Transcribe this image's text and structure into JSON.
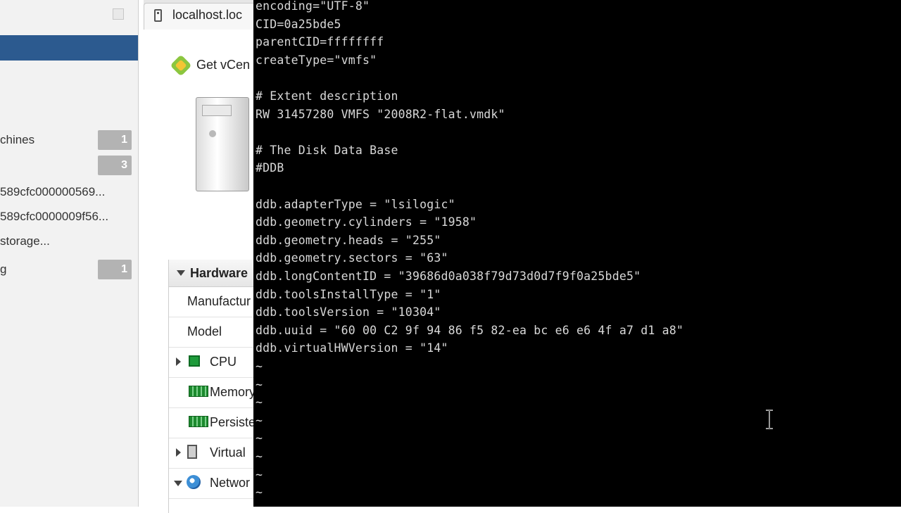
{
  "sidebar": {
    "items": [
      {
        "label": "chines",
        "badge": "1"
      },
      {
        "label": "",
        "badge": "3"
      },
      {
        "label": "589cfc000000569...",
        "badge": ""
      },
      {
        "label": "589cfc0000009f56...",
        "badge": ""
      },
      {
        "label": "storage...",
        "badge": ""
      },
      {
        "label": "g",
        "badge": "1"
      }
    ]
  },
  "tab": {
    "title": "localhost.loc"
  },
  "host_panel": {
    "get_vcenter_label": "Get vCen",
    "hardware": {
      "title": "Hardware",
      "rows": [
        {
          "label": "Manufactur"
        },
        {
          "label": "Model"
        },
        {
          "label": "CPU"
        },
        {
          "label": "Memory"
        },
        {
          "label": "Persiste"
        },
        {
          "label": "Virtual"
        },
        {
          "label": "Networ"
        }
      ]
    }
  },
  "terminal": {
    "lines": [
      "encoding=\"UTF-8\"",
      "CID=0a25bde5",
      "parentCID=ffffffff",
      "createType=\"vmfs\"",
      "",
      "# Extent description",
      "RW 31457280 VMFS \"2008R2-flat.vmdk\"",
      "",
      "# The Disk Data Base",
      "#DDB",
      "",
      "ddb.adapterType = \"lsilogic\"",
      "ddb.geometry.cylinders = \"1958\"",
      "ddb.geometry.heads = \"255\"",
      "ddb.geometry.sectors = \"63\"",
      "ddb.longContentID = \"39686d0a038f79d73d0d7f9f0a25bde5\"",
      "ddb.toolsInstallType = \"1\"",
      "ddb.toolsVersion = \"10304\"",
      "ddb.uuid = \"60 00 C2 9f 94 86 f5 82-ea bc e6 e6 4f a7 d1 a8\"",
      "ddb.virtualHWVersion = \"14\"",
      "~",
      "~",
      "~",
      "~",
      "~",
      "~",
      "~",
      "~"
    ]
  },
  "colors": {
    "sidebar_selected": "#2c5a8f",
    "terminal_bg": "#000000",
    "terminal_fg": "#d9d9d9",
    "badge_bg": "#b3b3b3"
  }
}
